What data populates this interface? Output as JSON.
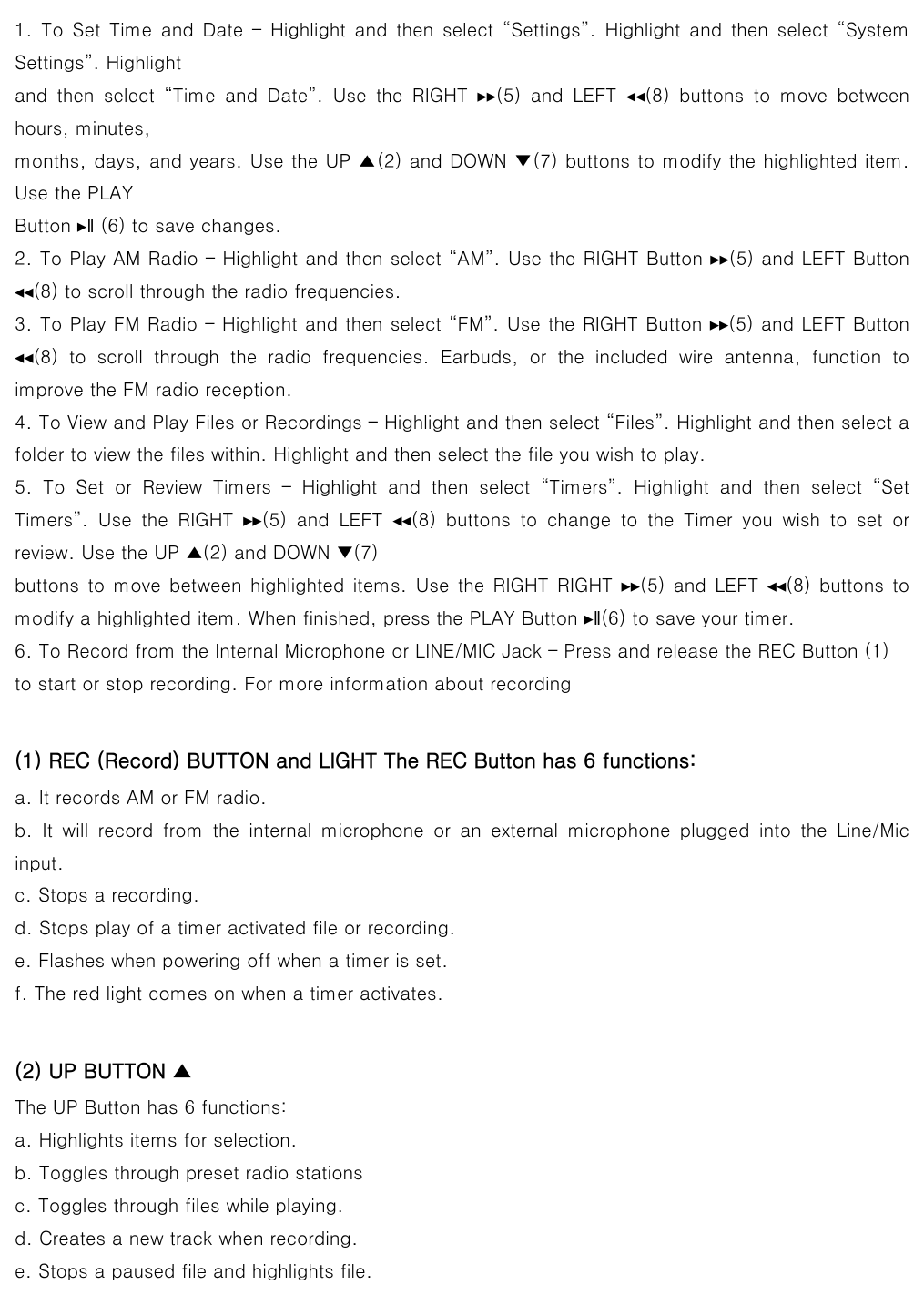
{
  "intro_paragraphs": [
    "1. To Set Time and Date – Highlight and then select “Settings”. Highlight and then select “System Settings”. Highlight",
    "and then select “Time and Date”. Use the RIGHT ▸▸(5) and LEFT ◂◂(8) buttons to move between hours, minutes,",
    "months, days, and years. Use the UP ▲(2) and DOWN ▼(7) buttons to modify the highlighted item. Use the PLAY",
    "Button ▸‖ (6) to save changes.",
    "2. To Play AM Radio – Highlight and then select “AM”. Use the RIGHT Button ▸▸(5) and LEFT Button ◂◂(8) to scroll through the radio frequencies.",
    "3. To Play FM Radio – Highlight and then select “FM”. Use the RIGHT Button ▸▸(5) and LEFT Button ◂◂(8) to scroll through the radio frequencies. Earbuds, or the included wire antenna, function to improve the FM radio reception.",
    "4. To View and Play Files or Recordings – Highlight and then select “Files”. Highlight and then select a folder to view the files within. Highlight and then select the file you wish to play.",
    "5. To Set or Review Timers – Highlight and then select “Timers”. Highlight and then select “Set Timers”. Use the RIGHT ▸▸(5) and LEFT ◂◂(8) buttons to change to the Timer you wish to set or review. Use the UP ▲(2) and DOWN ▼(7)",
    "buttons to move between highlighted items. Use the RIGHT RIGHT ▸▸(5) and LEFT ◂◂(8) buttons to modify a highlighted item. When finished, press the PLAY Button ▸‖(6) to save your timer.",
    "6. To Record from the Internal Microphone or LINE/MIC Jack – Press and release the REC Button (1) to start or stop recording. For more information about recording"
  ],
  "section1": {
    "heading": "(1) REC (Record) BUTTON and LIGHT The REC Button has 6 functions:",
    "items": [
      "a. It records AM or FM radio.",
      "b. It will record from the internal microphone or an external microphone plugged into the Line/Mic input.",
      "c. Stops a recording.",
      "d. Stops play of a timer activated file or recording.",
      "e. Flashes when powering off when a timer is set.",
      "f. The red light comes on when a timer activates."
    ]
  },
  "section2": {
    "heading": "(2) UP BUTTON ▲",
    "intro": "The UP Button has 6 functions:",
    "items": [
      "a. Highlights items for selection.",
      "b. Toggles through preset radio stations",
      "c. Toggles through files while playing.",
      "d. Creates a new track when recording.",
      "e. Stops a paused file and highlights file."
    ]
  }
}
